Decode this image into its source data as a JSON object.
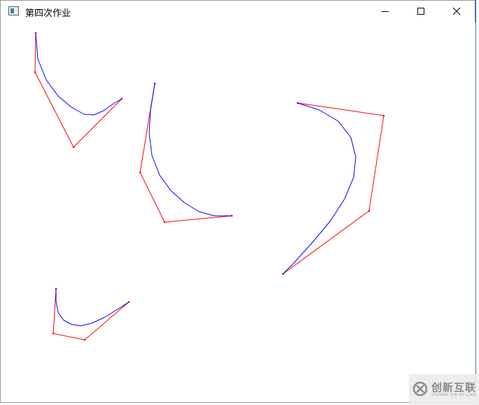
{
  "window": {
    "title": "第四次作业",
    "icon": "app-window-icon"
  },
  "controls": {
    "minimize_icon": "minimize-icon",
    "maximize_icon": "maximize-icon",
    "close_icon": "close-icon"
  },
  "drawing": {
    "colors": {
      "control_polygon": "#ff0000",
      "bezier_curve": "#0000ff",
      "background": "#ffffff"
    },
    "curves": [
      {
        "name": "curve-1",
        "control_points": [
          [
            50,
            15
          ],
          [
            49,
            71
          ],
          [
            104,
            178
          ],
          [
            173,
            109
          ]
        ],
        "curve_points": [
          [
            50,
            15
          ],
          [
            53,
            52
          ],
          [
            65,
            82
          ],
          [
            82,
            105
          ],
          [
            101,
            121
          ],
          [
            119,
            131
          ],
          [
            133,
            132
          ],
          [
            147,
            126
          ],
          [
            161,
            116
          ],
          [
            173,
            109
          ]
        ]
      },
      {
        "name": "curve-2",
        "control_points": [
          [
            220,
            87
          ],
          [
            199,
            214
          ],
          [
            234,
            285
          ],
          [
            330,
            276
          ]
        ],
        "curve_points": [
          [
            220,
            87
          ],
          [
            214,
            125
          ],
          [
            212,
            158
          ],
          [
            216,
            190
          ],
          [
            227,
            218
          ],
          [
            243,
            240
          ],
          [
            262,
            257
          ],
          [
            283,
            270
          ],
          [
            305,
            276
          ],
          [
            330,
            276
          ]
        ]
      },
      {
        "name": "curve-3",
        "control_points": [
          [
            424,
            115
          ],
          [
            547,
            133
          ],
          [
            526,
            269
          ],
          [
            403,
            359
          ]
        ],
        "curve_points": [
          [
            424,
            115
          ],
          [
            455,
            125
          ],
          [
            482,
            141
          ],
          [
            500,
            164
          ],
          [
            507,
            192
          ],
          [
            504,
            221
          ],
          [
            491,
            252
          ],
          [
            471,
            283
          ],
          [
            446,
            313
          ],
          [
            418,
            344
          ],
          [
            403,
            359
          ]
        ]
      },
      {
        "name": "curve-4",
        "control_points": [
          [
            79,
            380
          ],
          [
            75,
            444
          ],
          [
            120,
            453
          ],
          [
            183,
            399
          ]
        ],
        "curve_points": [
          [
            79,
            380
          ],
          [
            79,
            398
          ],
          [
            82,
            414
          ],
          [
            90,
            425
          ],
          [
            101,
            431
          ],
          [
            115,
            433
          ],
          [
            131,
            429
          ],
          [
            148,
            421
          ],
          [
            166,
            410
          ],
          [
            183,
            399
          ]
        ]
      }
    ]
  },
  "watermark": {
    "text": "创新互联",
    "subtext": "CHUANG XIN HU LIAN",
    "logo_icon": "brand-logo-icon"
  }
}
